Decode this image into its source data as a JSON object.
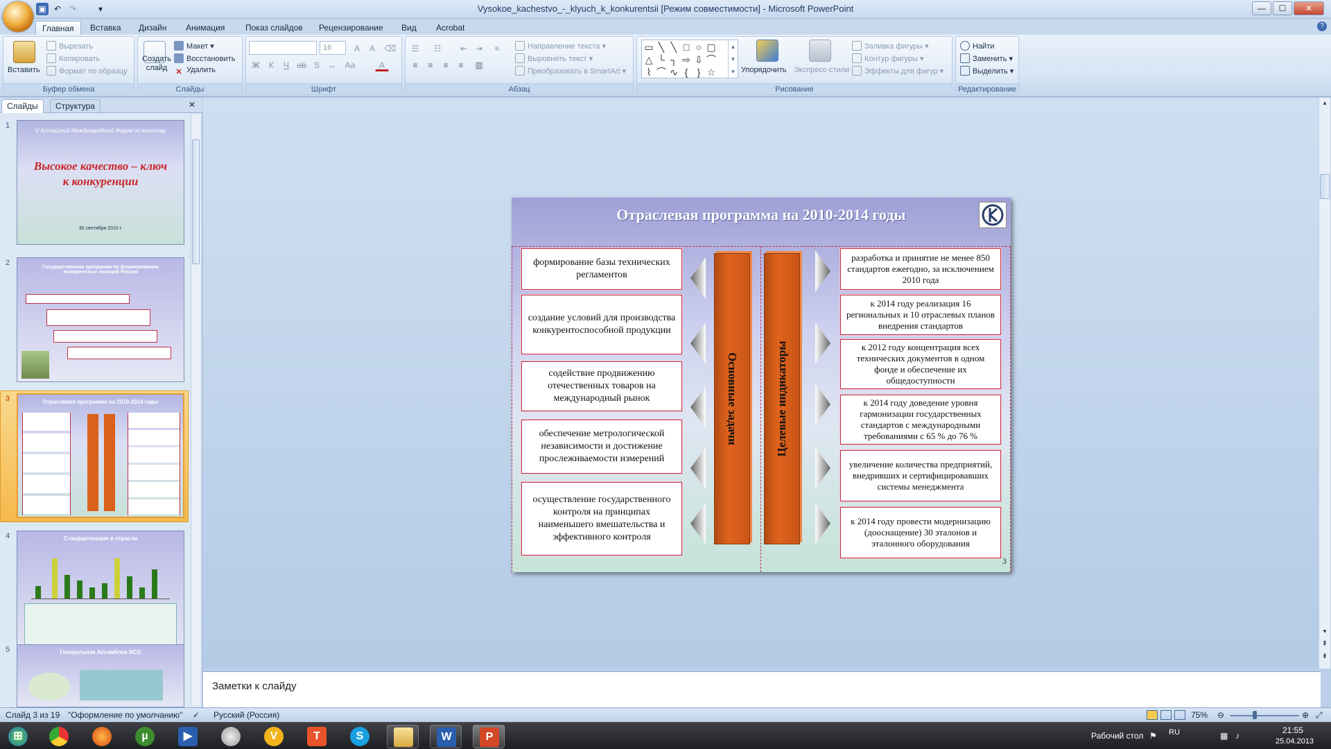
{
  "window": {
    "title": "Vysokoe_kachestvo_-_klyuch_k_konkurentsii [Режим совместимости] - Microsoft PowerPoint",
    "min": "—",
    "max": "☐",
    "close": "✕"
  },
  "tabs": [
    "Главная",
    "Вставка",
    "Дизайн",
    "Анимация",
    "Показ слайдов",
    "Рецензирование",
    "Вид",
    "Acrobat"
  ],
  "ribbon": {
    "clipboard": {
      "paste": "Вставить",
      "cut": "Вырезать",
      "copy": "Копировать",
      "format_painter": "Формат по образцу",
      "label": "Буфер обмена"
    },
    "slides": {
      "new_slide": "Создать слайд",
      "layout": "Макет",
      "reset": "Восстановить",
      "delete": "Удалить",
      "label": "Слайды"
    },
    "font": {
      "font_name": "",
      "font_size": "16",
      "label": "Шрифт"
    },
    "paragraph": {
      "text_direction": "Направление текста",
      "align_text": "Выровнять текст",
      "smartart": "Преобразовать в SmartArt",
      "label": "Абзац"
    },
    "drawing": {
      "arrange": "Упорядочить",
      "quick_styles": "Экспресс-стили",
      "fill": "Заливка фигуры",
      "outline": "Контур фигуры",
      "effects": "Эффекты для фигур",
      "label": "Рисование"
    },
    "editing": {
      "find": "Найти",
      "replace": "Заменить",
      "select": "Выделить",
      "label": "Редактирование"
    }
  },
  "panel_tabs": [
    "Слайды",
    "Структура"
  ],
  "thumbnails": [
    {
      "num": "1",
      "title": "V Алтайский Международный Форум по качеству",
      "main": "Высокое качество – ключ к конкуренции",
      "date": "30 сентября 2010 г."
    },
    {
      "num": "2",
      "title": "Государственная программа по формированию конкурентных позиций России"
    },
    {
      "num": "3",
      "title": "Отраслевая программа на 2010-2014 годы"
    },
    {
      "num": "4",
      "title": "Стандартизация в отрасли"
    },
    {
      "num": "5",
      "title": "Генеральная Ассамблея ИСО"
    }
  ],
  "slide": {
    "title": "Отраслевая программа на 2010-2014 годы",
    "left_boxes": [
      "формирование базы технических регламентов",
      "создание условий для производства конкурентоспособной продукции",
      "содействие продвижению отечественных товаров на международный рынок",
      "обеспечение метрологической независимости и достижение прослеживаемости измерений",
      "осуществление государственного контроля на принципах наименьшего вмешательства и эффективного контроля"
    ],
    "bar1": "Основные задачи",
    "bar2": "Целевые индикаторы",
    "right_boxes": [
      "разработка и принятие не менее 850 стандартов ежегодно, за исключением 2010 года",
      "к 2014 году реализация 16 региональных и 10 отраслевых планов внедрения стандартов",
      "к 2012 году концентрация всех технических документов в одном фонде и обеспечение их общедоступности",
      "к 2014 году доведение уровня гармонизации государственных стандартов с международными требованиями с 65 % до 76 %",
      "увеличение количества предприятий, внедривших и сертифицировавших системы менеджмента",
      "к 2014 году провести модернизацию (дооснащение) 30 эталонов и эталонного оборудования"
    ],
    "page_num": "3"
  },
  "notes_placeholder": "Заметки к слайду",
  "status": {
    "slide": "Слайд 3 из 19",
    "theme": "\"Оформление по умолчанию\"",
    "lang": "Русский (Россия)",
    "zoom": "75%",
    "zoom_level": 0.75
  },
  "taskbar": {
    "desktop": "Рабочий стол",
    "lang": "RU",
    "time": "21:55",
    "date": "25.04.2013"
  },
  "colors": {
    "accent": "#e0641d",
    "box_border": "#c0304a",
    "ribbon": "#d6e4f4"
  }
}
